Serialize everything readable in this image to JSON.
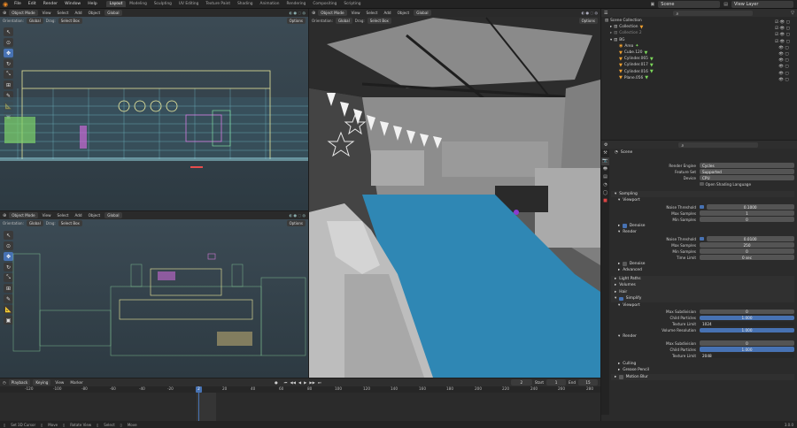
{
  "topbar": {
    "menus": [
      "File",
      "Edit",
      "Render",
      "Window",
      "Help"
    ],
    "workspaces": [
      "Layout",
      "Modeling",
      "Sculpting",
      "UV Editing",
      "Texture Paint",
      "Shading",
      "Animation",
      "Rendering",
      "Compositing",
      "Scripting"
    ],
    "active_workspace": "Layout",
    "scene": "Scene",
    "view_layer": "View Layer"
  },
  "viewport_tl": {
    "mode": "Object Mode",
    "menus": [
      "View",
      "Select",
      "Add",
      "Object"
    ],
    "transform": "Global",
    "orientation_label": "Orientation:",
    "orientation_value": "Global",
    "drag_label": "Drag:",
    "drag_value": "Select Box",
    "options": "Options"
  },
  "viewport_bl": {
    "mode": "Object Mode",
    "menus": [
      "View",
      "Select",
      "Add",
      "Object"
    ],
    "transform": "Global",
    "orientation_label": "Orientation:",
    "orientation_value": "Global",
    "drag_label": "Drag:",
    "drag_value": "Select Box",
    "options": "Options"
  },
  "viewport_main": {
    "mode": "Object Mode",
    "menus": [
      "View",
      "Select",
      "Add",
      "Object"
    ],
    "transform": "Global",
    "orientation_label": "Orientation:",
    "orientation_value": "Global",
    "drag_label": "Drag:",
    "drag_value": "Select Box",
    "options": "Options"
  },
  "outliner": {
    "scene_collection": "Scene Collection",
    "collection": "Collection",
    "collection_2": "Collection 2",
    "bg": "BG",
    "items": [
      "Area",
      "Cube.120",
      "Cylinder.065",
      "Cylinder.017",
      "Cylinder.016",
      "Plane.056"
    ]
  },
  "properties": {
    "scene_label": "Scene",
    "render_engine_label": "Render Engine",
    "render_engine": "Cycles",
    "feature_set_label": "Feature Set",
    "feature_set": "Supported",
    "device_label": "Device",
    "device": "CPU",
    "osl_label": "Open Shading Language",
    "sampling": "Sampling",
    "viewport": "Viewport",
    "noise_threshold_label": "Noise Threshold",
    "vp_noise_threshold": "0.1000",
    "max_samples_label": "Max Samples",
    "vp_max_samples": "1",
    "min_samples_label": "Min Samples",
    "vp_min_samples": "0",
    "denoise_label": "Denoise",
    "render": "Render",
    "r_noise_threshold": "0.0100",
    "r_max_samples": "250",
    "r_min_samples": "0",
    "time_limit_label": "Time Limit",
    "r_time_limit": "0 sec",
    "advanced": "Advanced",
    "light_paths": "Light Paths",
    "volumes": "Volumes",
    "hair": "Hair",
    "simplify": "Simplify",
    "s_viewport": "Viewport",
    "max_subdivision_label": "Max Subdivision",
    "s_vp_max_subdiv": "0",
    "child_particles_label": "Child Particles",
    "s_vp_child": "1.000",
    "texture_limit_label": "Texture Limit",
    "s_vp_texture": "1024",
    "volume_resolution_label": "Volume Resolution",
    "s_vp_volume": "1.000",
    "s_render": "Render",
    "s_r_max_subdiv": "0",
    "s_r_child": "1.000",
    "s_r_texture": "2048",
    "culling": "Culling",
    "grease_pencil": "Grease Pencil",
    "motion_blur": "Motion Blur"
  },
  "timeline": {
    "menus": [
      "Playback",
      "Keying",
      "View",
      "Marker"
    ],
    "frame_current": "2",
    "start_label": "Start",
    "start": "1",
    "end_label": "End",
    "end": "15",
    "ticks": [
      "-120",
      "-100",
      "-80",
      "-60",
      "-40",
      "-20",
      "0",
      "20",
      "40",
      "60",
      "80",
      "100",
      "120",
      "140",
      "160",
      "180",
      "200",
      "220",
      "240",
      "260",
      "280"
    ],
    "cursor_label": "2"
  },
  "statusbar": {
    "items": [
      "Set 3D Cursor",
      "Move",
      "Rotate View",
      "Select",
      "Move"
    ],
    "version": "3.0.0"
  },
  "colors": {
    "accent": "#4772b3",
    "floor": "#2e8bc0",
    "wire_bg": "#3d5462"
  }
}
